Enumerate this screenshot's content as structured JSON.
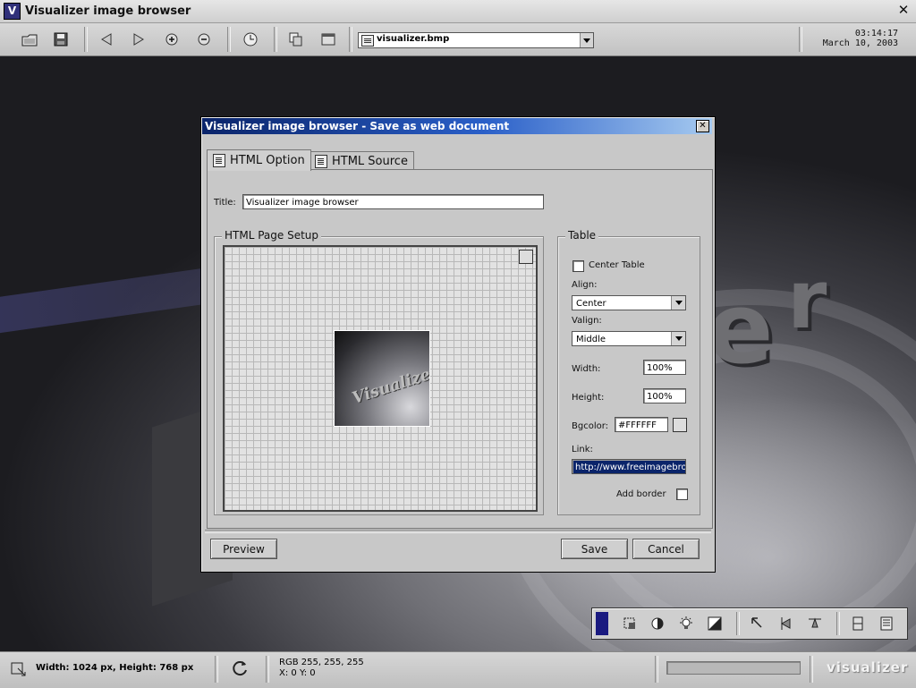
{
  "app": {
    "logo_letter": "V",
    "title": "Visualizer image browser",
    "close_glyph": "✕"
  },
  "toolbar": {
    "buttons": [
      "open-folder-icon",
      "save-icon",
      "back-arrow-icon",
      "forward-arrow-icon",
      "zoom-in-icon",
      "zoom-out-icon",
      "slideshow-timer-icon",
      "copy-icon",
      "window-icon"
    ],
    "file_combo_value": "visualizer.bmp"
  },
  "clock": {
    "time": "03:14:17",
    "date": "March 10, 2003"
  },
  "dialog": {
    "title": "Visualizer image browser - Save as web document",
    "close_glyph": "✕",
    "tabs": [
      {
        "label": "HTML Option",
        "active": true
      },
      {
        "label": "HTML Source",
        "active": false
      }
    ],
    "title_field": {
      "label": "Title:",
      "value": "Visualizer image browser"
    },
    "page_setup": {
      "legend": "HTML Page Setup",
      "thumbnail_text": "Visualizer"
    },
    "table": {
      "legend": "Table",
      "center_table_label": "Center Table",
      "center_table_checked": false,
      "align_label": "Align:",
      "align_value": "Center",
      "valign_label": "Valign:",
      "valign_value": "Middle",
      "width_label": "Width:",
      "width_value": "100%",
      "height_label": "Height:",
      "height_value": "100%",
      "bgcolor_label": "Bgcolor:",
      "bgcolor_value": "#FFFFFF",
      "link_label": "Link:",
      "link_value": "http://www.freeimagebro",
      "add_border_label": "Add border",
      "add_border_checked": false
    },
    "buttons": {
      "preview": "Preview",
      "save": "Save",
      "cancel": "Cancel"
    }
  },
  "palette": {
    "swatch_color": "#1a1a80",
    "tools": [
      "crop-select-icon",
      "contrast-icon",
      "brightness-bulb-icon",
      "levels-icon",
      "rotate-left-icon",
      "flip-vertical-icon",
      "rotate-right-icon",
      "panel-icon",
      "properties-icon"
    ]
  },
  "status": {
    "dimensions": "Width: 1024 px, Height: 768 px",
    "rgb": "RGB 255, 255, 255",
    "coords": "X: 0  Y: 0",
    "progress": 0,
    "brand": "visualizer"
  },
  "colors": {
    "dialog_title_start": "#0a246a",
    "dialog_title_end": "#a6caf0",
    "link_selection": "#0a246a"
  }
}
